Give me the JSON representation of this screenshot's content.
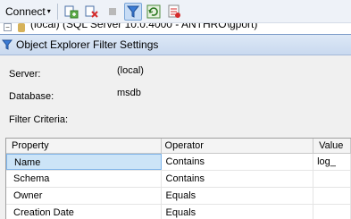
{
  "toolbar": {
    "connect_label": "Connect",
    "connect_arrow": "▾"
  },
  "tree": {
    "partial_text": "(local) (SQL Server 10.0.4000 - ANTHRO\\gport)"
  },
  "dialog": {
    "title": "Object Explorer Filter Settings",
    "server_label": "Server:",
    "server_value": "(local)",
    "database_label": "Database:",
    "database_value": "msdb",
    "criteria_label": "Filter Criteria:"
  },
  "grid": {
    "headers": {
      "property": "Property",
      "operator": "Operator",
      "value": "Value"
    },
    "rows": [
      {
        "property": "Name",
        "operator": "Contains",
        "value": "log_"
      },
      {
        "property": "Schema",
        "operator": "Contains",
        "value": ""
      },
      {
        "property": "Owner",
        "operator": "Equals",
        "value": ""
      },
      {
        "property": "Creation Date",
        "operator": "Equals",
        "value": ""
      }
    ]
  },
  "colors": {
    "titlebar_top": "#dde8f6",
    "titlebar_bottom": "#c9d9ef",
    "selection": "#cce4f7",
    "filter_icon": "#3a7bd5"
  },
  "icons": [
    "new-query-icon",
    "disconnect-icon",
    "stop-icon",
    "filter-icon",
    "refresh-icon",
    "activity-monitor-icon",
    "funnel-icon",
    "expand-minus-icon",
    "database-icon"
  ]
}
